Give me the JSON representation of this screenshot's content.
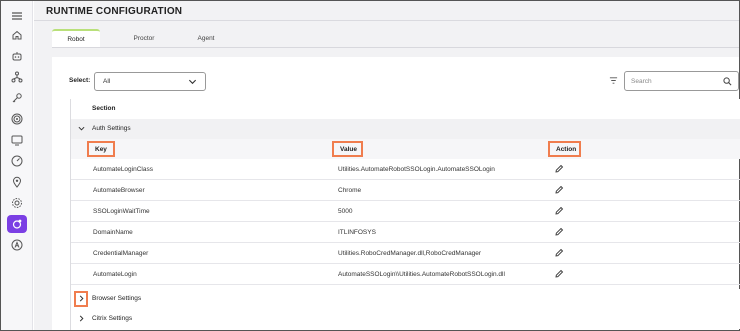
{
  "page": {
    "title": "RUNTIME CONFIGURATION"
  },
  "sidebar": {
    "icons": [
      "menu-icon",
      "home-icon",
      "robot-icon",
      "network-icon",
      "key-icon",
      "target-icon",
      "monitor-icon",
      "gauge-icon",
      "location-icon",
      "settings-icon",
      "runtime-config-icon",
      "agent-icon"
    ]
  },
  "tabs": [
    {
      "label": "Robot",
      "active": true
    },
    {
      "label": "Proctor",
      "active": false
    },
    {
      "label": "Agent",
      "active": false
    }
  ],
  "filter": {
    "select_label": "Select:",
    "select_value": "All",
    "search_placeholder": "Search"
  },
  "table": {
    "section_header": "Section",
    "groups": [
      {
        "label": "Auth Settings",
        "expanded": true
      },
      {
        "label": "Browser Settings",
        "expanded": false
      },
      {
        "label": "Citrix Settings",
        "expanded": false
      }
    ],
    "columns": {
      "key": "Key",
      "value": "Value",
      "action": "Action"
    },
    "rows": [
      {
        "key": "AutomateLoginClass",
        "value": "Utilities.AutomateRobotSSOLogin.AutomateSSOLogin"
      },
      {
        "key": "AutomateBrowser",
        "value": "Chrome"
      },
      {
        "key": "SSOLoginWaitTime",
        "value": "5000"
      },
      {
        "key": "DomainName",
        "value": "ITLINFOSYS"
      },
      {
        "key": "CredentialManager",
        "value": "Utilities.RoboCredManager.dll,RoboCredManager"
      },
      {
        "key": "AutomateLogin",
        "value": "AutomateSSOLogin\\\\Utilities.AutomateRobotSSOLogin.dll"
      }
    ]
  },
  "colors": {
    "accent": "#7b3fe4",
    "highlight": "#f07d4e",
    "tab_active": "#b9e07a"
  }
}
